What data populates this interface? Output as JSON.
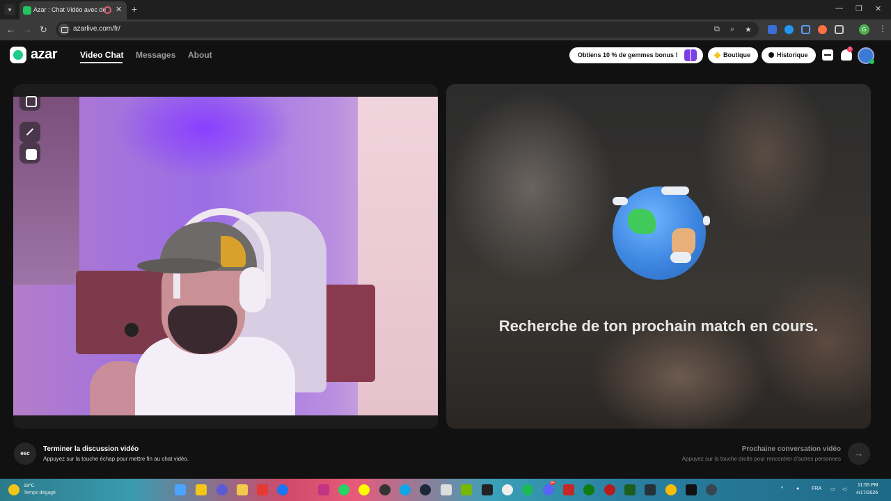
{
  "browser": {
    "tab_title": "Azar : Chat Vidéo avec de n",
    "url": "azarlive.com/fr/",
    "icons": {
      "tab_menu": "chevron-down-icon",
      "close_tab": "close-icon",
      "new_tab": "plus-icon",
      "minimize": "minimize-icon",
      "maximize": "maximize-icon",
      "close_window": "close-icon",
      "back": "back-arrow-icon",
      "forward": "forward-arrow-icon",
      "reload": "reload-icon",
      "bookmark": "star-icon"
    },
    "profile_letter": "G"
  },
  "app": {
    "logo_text": "azar",
    "nav": {
      "video_chat": "Video Chat",
      "messages": "Messages",
      "about": "About"
    },
    "promo_label": "Obtiens 10 % de gemmes bonus !",
    "boutique_label": "Boutique",
    "historique_label": "Historique",
    "notification_count": "7",
    "accent_color": "#1fcc8a"
  },
  "right_panel": {
    "status_text": "Recherche de ton prochain match en cours."
  },
  "footer": {
    "esc_key": "esc",
    "end_title": "Terminer la discussion vidéo",
    "end_subtitle": "Appuyez sur la touche échap pour mettre fin au chat vidéo.",
    "next_title": "Prochaine conversation vidéo",
    "next_subtitle": "Appuyez sur la touche droite pour rencontrer d'autres personnes"
  },
  "taskbar": {
    "temperature": "19°C",
    "weather": "Temps dégagé",
    "language": "FRA",
    "time": "11:55 PM",
    "date": "4/17/2026",
    "discord_badge": "9+"
  }
}
